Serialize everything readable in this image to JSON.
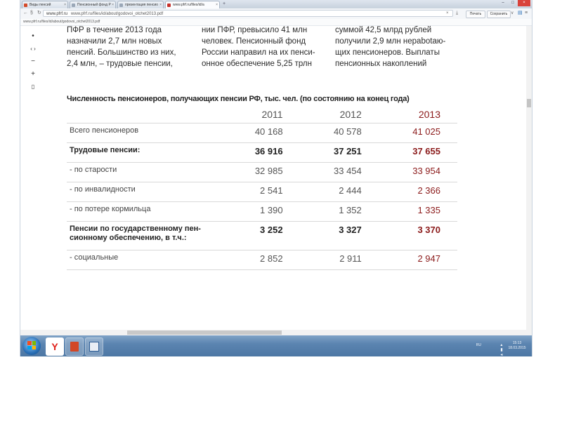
{
  "browser": {
    "tabs": [
      {
        "label": "Виды пенсий",
        "fav_color": "#d44a2a"
      },
      {
        "label": "Пенсионный фонд Р",
        "fav_color": "#9aa7b7"
      },
      {
        "label": "презентация пенсио",
        "fav_color": "#9aa7b7"
      },
      {
        "label": "www.pfrf.ru/files/id/a",
        "fav_color": "#c6302a",
        "active": true
      }
    ],
    "url_domain": "www.pfrf.ru",
    "url_full": "www.pfrf.ru/files/id/about/godovoi_otchet2013.pdf",
    "subbar_text": "www.pfrf.ru/files/id/about/godovoi_otchet2013.pdf",
    "print_button": "Печать",
    "save_button": "Сохранить"
  },
  "document": {
    "col1": [
      "ПФР в течение 2013 года",
      "назначили 2,7 млн новых",
      "пенсий. Большинство из них,",
      "2,4 млн, – трудовые пенсии,"
    ],
    "col2": [
      "нии ПФР, превысило 41 млн",
      "человек. Пенсионный фонд",
      "России направил на их пенси-",
      "онное обеспечение 5,25 трлн"
    ],
    "col3": [
      "суммой 42,5 млрд рублей",
      "получили 2,9 млн нераbotаю-",
      "щих пенсионеров. Выплаты",
      "пенсионных накоплений"
    ],
    "table_title": "Численность пенсионеров, получающих пенсии РФ, тыс. чел. (по состоянию на конец года)",
    "years": [
      "2011",
      "2012",
      "2013"
    ],
    "rows": [
      {
        "label": "Всего пенсионеров",
        "values": [
          "40 168",
          "40 578",
          "41 025"
        ]
      },
      {
        "label": "Трудовые пенсии:",
        "values": [
          "36 916",
          "37 251",
          "37 655"
        ]
      },
      {
        "label": "- по старости",
        "values": [
          "32 985",
          "33 454",
          "33 954"
        ]
      },
      {
        "label": "- по инвалидности",
        "values": [
          "2 541",
          "2 444",
          "2 366"
        ]
      },
      {
        "label": "- по потере кормильца",
        "values": [
          "1 390",
          "1 352",
          "1 335"
        ]
      },
      {
        "label": "Пенсии по государственному пенсионному обеспечению, в т.ч.:",
        "label_lines": [
          "Пенсии по государственному пен-",
          "сионному обеспечению, в т.ч.:"
        ],
        "values": [
          "3 252",
          "3 327",
          "3 370"
        ]
      },
      {
        "label": "- социальные",
        "values": [
          "2 852",
          "2 911",
          "2 947"
        ]
      }
    ]
  },
  "taskbar": {
    "lang": "RU",
    "time": "15:13",
    "date": "18.03.2015"
  },
  "colors": {
    "accent_year": "#8b1a1a",
    "taskbar": "#5b84b0"
  }
}
